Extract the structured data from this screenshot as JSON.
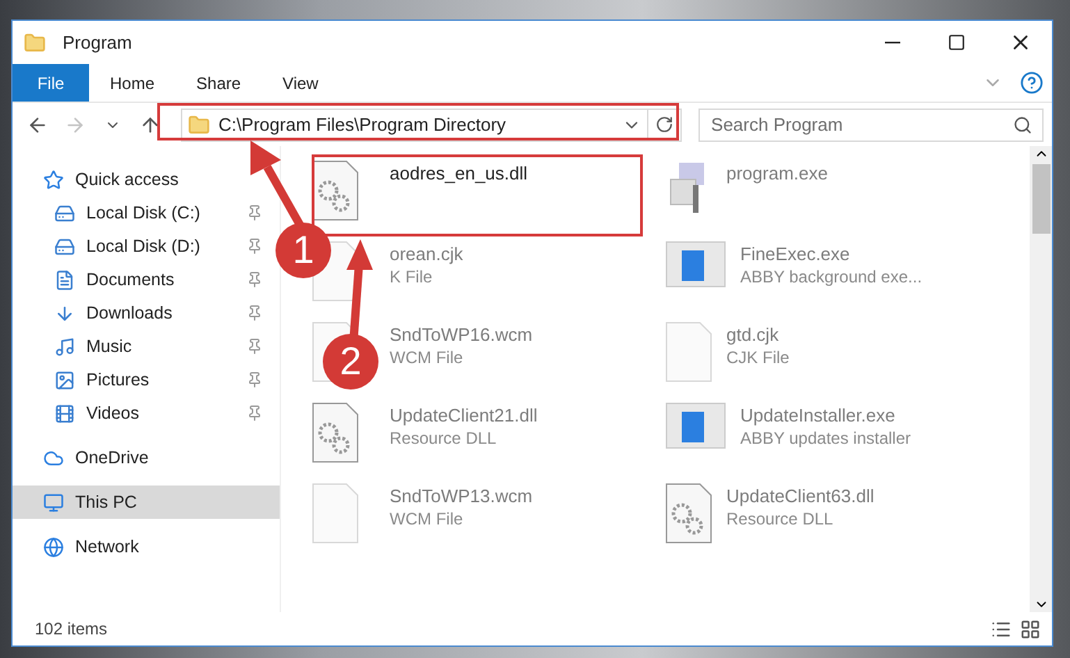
{
  "window": {
    "title": "Program"
  },
  "ribbon_tabs": [
    {
      "label": "File",
      "kind": "file"
    },
    {
      "label": "Home",
      "kind": "tab"
    },
    {
      "label": "Share",
      "kind": "tab"
    },
    {
      "label": "View",
      "kind": "tab"
    }
  ],
  "address": {
    "path": "C:\\Program Files\\Program Directory"
  },
  "search": {
    "placeholder": "Search Program"
  },
  "sidebar": {
    "items": [
      {
        "label": "Quick access",
        "selected": false,
        "children": [
          {
            "label": "Local Disk (C:)",
            "pinned": true,
            "selected": false
          },
          {
            "label": "Local Disk (D:)",
            "pinned": true,
            "selected": false
          },
          {
            "label": "Documents",
            "pinned": true,
            "selected": false
          },
          {
            "label": "Downloads",
            "pinned": true,
            "selected": false
          },
          {
            "label": "Music",
            "pinned": true,
            "selected": false
          },
          {
            "label": "Pictures",
            "pinned": true,
            "selected": false
          },
          {
            "label": "Videos",
            "pinned": true,
            "selected": false
          }
        ]
      },
      {
        "label": "OneDrive",
        "selected": false
      },
      {
        "label": "This PC",
        "selected": true
      },
      {
        "label": "Network",
        "selected": false
      }
    ]
  },
  "files": [
    {
      "name": "aodres_en_us.dll",
      "kind": "dll",
      "blurred": false
    },
    {
      "name": "program.exe",
      "kind": "app",
      "blurred": true
    },
    {
      "name": "orean.cjk",
      "type": "K File",
      "kind": "blank",
      "blurred": true
    },
    {
      "name": "FineExec.exe",
      "type": "ABBY background exe...",
      "kind": "window",
      "blurred": true
    },
    {
      "name": "SndToWP16.wcm",
      "type": "WCM File",
      "kind": "blank",
      "blurred": true
    },
    {
      "name": "gtd.cjk",
      "type": "CJK File",
      "kind": "blank",
      "blurred": true
    },
    {
      "name": "UpdateClient21.dll",
      "type": "Resource DLL",
      "kind": "dll",
      "blurred": true
    },
    {
      "name": "UpdateInstaller.exe",
      "type": "ABBY updates installer",
      "kind": "window",
      "blurred": true
    },
    {
      "name": "SndToWP13.wcm",
      "type": "WCM File",
      "kind": "blank",
      "blurred": true
    },
    {
      "name": "UpdateClient63.dll",
      "type": "Resource DLL",
      "kind": "dll",
      "blurred": true
    }
  ],
  "status_bar": {
    "count": "102 items"
  },
  "annotations": {
    "markers": [
      {
        "label": "1"
      },
      {
        "label": "2"
      }
    ]
  }
}
